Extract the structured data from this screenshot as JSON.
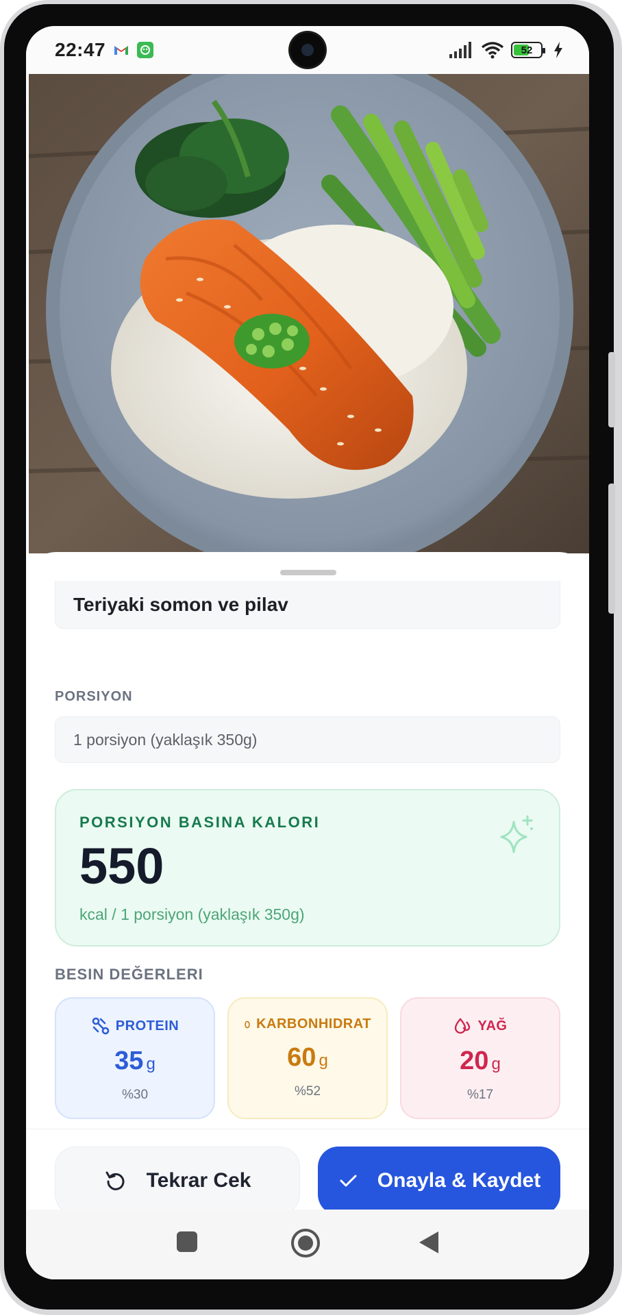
{
  "status_bar": {
    "time": "22:47",
    "battery_level": "52",
    "icons": [
      "gmail-icon",
      "app-notification-icon",
      "signal-icon",
      "wifi-icon",
      "battery-icon",
      "charging-icon"
    ]
  },
  "photo": {
    "subject": "teriyaki-salmon-plate"
  },
  "form": {
    "food_name": "Teriyaki somon ve pilav",
    "portion_label": "PORSIYON",
    "portion_value": "1 porsiyon (yaklaşık 350g)"
  },
  "calorie_card": {
    "label": "PORSIYON BASINA KALORI",
    "value": "550",
    "unit": "kcal / 1 porsiyon (yaklaşık 350g)"
  },
  "nutrients": {
    "label": "BESIN DEĞERLERI",
    "items": [
      {
        "name": "PROTEIN",
        "value": "35",
        "unit": "g",
        "percent": "%30",
        "color": "#2c5cd6",
        "icon": "protein-molecule-icon"
      },
      {
        "name": "KARBONHIDRAT",
        "value": "60",
        "unit": "g",
        "percent": "%52",
        "color": "#c97a10",
        "icon": "grain-icon"
      },
      {
        "name": "YAĞ",
        "value": "20",
        "unit": "g",
        "percent": "%17",
        "color": "#cf2650",
        "icon": "oil-drop-icon"
      }
    ]
  },
  "actions": {
    "retake_label": "Tekrar Cek",
    "confirm_label": "Onayla & Kaydet"
  },
  "colors": {
    "primary": "#2656dd",
    "calorie_green": "#177a4e",
    "calorie_bg": "#ebfaf2"
  }
}
